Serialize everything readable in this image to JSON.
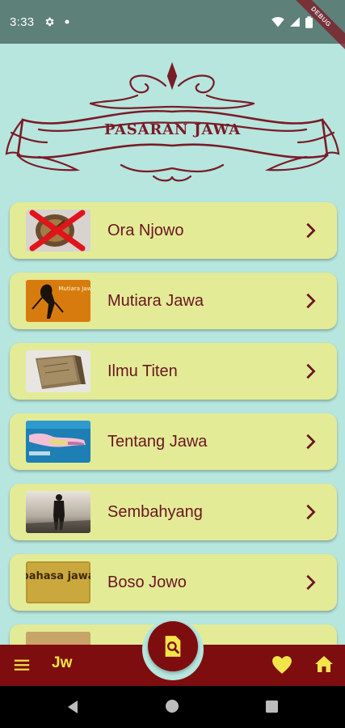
{
  "status_bar": {
    "time": "3:33",
    "debug_label": "DEBUG",
    "icons": [
      "gear-icon",
      "dot-icon",
      "wifi-icon",
      "signal-icon",
      "battery-icon"
    ]
  },
  "header": {
    "title": "PASARAN JAWA"
  },
  "menu": {
    "items": [
      {
        "label": "Ora Njowo",
        "thumb": "wayang-crossed-out"
      },
      {
        "label": "Mutiara Jawa",
        "thumb": "wayang-puppet-mutiara-jawa",
        "thumb_text": "Mutiara Jawa"
      },
      {
        "label": "Ilmu Titen",
        "thumb": "old-book"
      },
      {
        "label": "Tentang Jawa",
        "thumb": "java-map"
      },
      {
        "label": "Sembahyang",
        "thumb": "person-silhouette"
      },
      {
        "label": "Boso Jowo",
        "thumb": "bahasa-jawa-text",
        "thumb_text": "bahasa jawa"
      },
      {
        "label": "",
        "thumb": "partially-hidden"
      }
    ]
  },
  "bottom_bar": {
    "app_abbr": "Jw",
    "icons": [
      "hamburger-menu-icon",
      "search-document-icon",
      "heart-icon",
      "home-icon"
    ]
  },
  "colors": {
    "background": "#b6e6dd",
    "status_bar": "#5d8078",
    "card": "#e3eb97",
    "text_maroon": "#6b1520",
    "bottom_bar": "#7e0d0f",
    "accent_yellow": "#f2e54a"
  }
}
